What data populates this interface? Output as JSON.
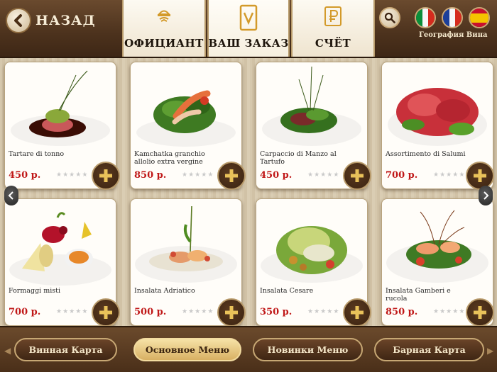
{
  "header": {
    "back_label": "НАЗАД",
    "tabs": [
      {
        "label": "ОФИЦИАНТ",
        "icon": "waiter-bell-icon"
      },
      {
        "label": "ВАШ ЗАКАЗ",
        "icon": "order-document-icon"
      },
      {
        "label": "СЧЁТ",
        "icon": "ruble-icon"
      }
    ],
    "geography_label": "География Вина",
    "flags": [
      "italy-flag-icon",
      "france-flag-icon",
      "spain-flag-icon"
    ]
  },
  "menu_items": [
    {
      "name": "Tartare di tonno",
      "price": "450 р.",
      "rating": 0
    },
    {
      "name": "Kamchatka granchio allolio extra vergine",
      "price": "850 р.",
      "rating": 0
    },
    {
      "name": "Carpaccio di Manzo al Tartufo",
      "price": "450 р.",
      "rating": 0
    },
    {
      "name": "Assortimento di Salumi",
      "price": "700 р.",
      "rating": 0
    },
    {
      "name": "Formaggi misti",
      "price": "700 р.",
      "rating": 0
    },
    {
      "name": "Insalata  Adriatico",
      "price": "500 р.",
      "rating": 0
    },
    {
      "name": "Insalata  Cesare",
      "price": "350 р.",
      "rating": 0
    },
    {
      "name": "Insalata  Gamberi e rucola",
      "price": "850 р.",
      "rating": 0
    }
  ],
  "footer": {
    "buttons": [
      {
        "label": "Винная Карта",
        "active": false
      },
      {
        "label": "Основное Меню",
        "active": true
      },
      {
        "label": "Новинки Меню",
        "active": false
      },
      {
        "label": "Барная Карта",
        "active": false
      }
    ]
  },
  "colors": {
    "brand_brown": "#4c321d",
    "price_red": "#c01818",
    "active_gold": "#d8b063"
  }
}
